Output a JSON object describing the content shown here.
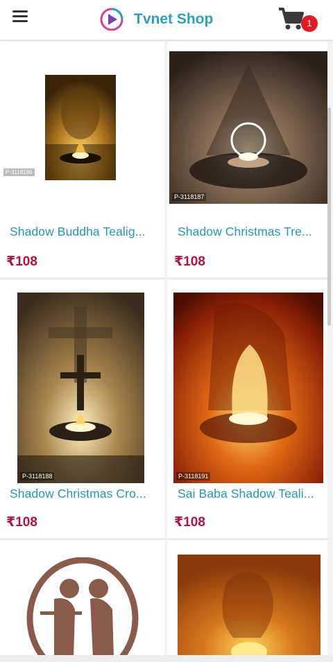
{
  "header": {
    "app_name": "Tvnet Shop",
    "menu_icon": "hamburger-menu-icon",
    "cart_icon": "shopping-cart-icon",
    "cart_count": "1",
    "brand_color": "#2aa0c6",
    "badge_color": "#e21b23"
  },
  "products": [
    {
      "title": "Shadow Buddha Tealig...",
      "price": "₹108",
      "sku": "P-3118186"
    },
    {
      "title": "Shadow Christmas Tre...",
      "price": "₹108",
      "sku": "P-3118187"
    },
    {
      "title": "Shadow Christmas Cro...",
      "price": "₹108",
      "sku": "P-3118188"
    },
    {
      "title": "Sai Baba Shadow Teali...",
      "price": "₹108",
      "sku": "P-3118191"
    },
    {
      "title": "",
      "price": "",
      "sku": ""
    },
    {
      "title": "",
      "price": "",
      "sku": ""
    }
  ],
  "colors": {
    "title": "#2696b9",
    "price": "#b3143b"
  }
}
